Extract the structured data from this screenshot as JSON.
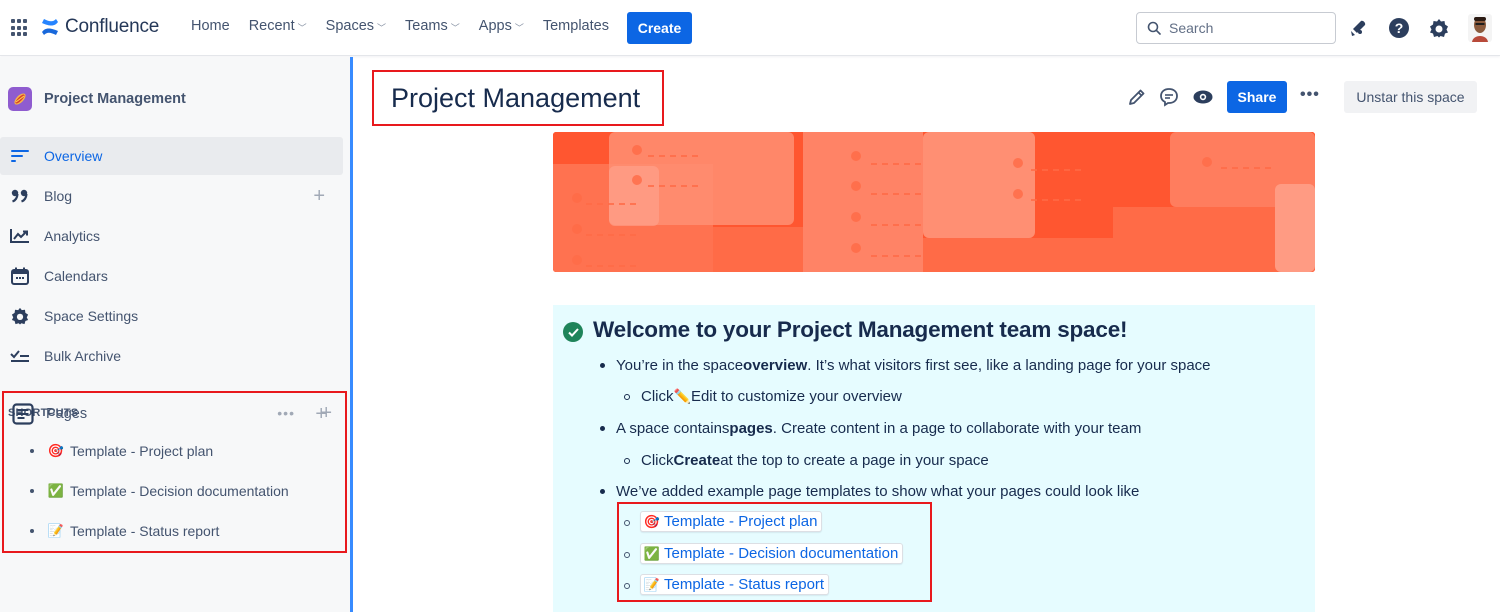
{
  "topnav": {
    "product_name": "Confluence",
    "nav_items": [
      {
        "label": "Home",
        "has_dropdown": false
      },
      {
        "label": "Recent",
        "has_dropdown": true
      },
      {
        "label": "Spaces",
        "has_dropdown": true
      },
      {
        "label": "Teams",
        "has_dropdown": true
      },
      {
        "label": "Apps",
        "has_dropdown": true
      },
      {
        "label": "Templates",
        "has_dropdown": false
      }
    ],
    "create_label": "Create",
    "search_placeholder": "Search",
    "icons": [
      "notifications-icon",
      "help-icon",
      "settings-icon",
      "user-avatar"
    ]
  },
  "sidebar": {
    "space_name": "Project Management",
    "items": [
      {
        "label": "Overview",
        "icon": "overview-icon",
        "active": true
      },
      {
        "label": "Blog",
        "icon": "quote-icon",
        "active": false,
        "has_add": true
      },
      {
        "label": "Analytics",
        "icon": "analytics-icon",
        "active": false
      },
      {
        "label": "Calendars",
        "icon": "calendar-icon",
        "active": false
      },
      {
        "label": "Space Settings",
        "icon": "gear-icon",
        "active": false
      },
      {
        "label": "Bulk Archive",
        "icon": "bulk-archive-icon",
        "active": false
      }
    ],
    "shortcuts_label": "SHORTCUTS",
    "pages_label": "Pages",
    "pages": [
      {
        "emoji": "🎯",
        "label": "Template - Project plan"
      },
      {
        "emoji": "✅",
        "label": "Template - Decision documentation"
      },
      {
        "emoji": "📝",
        "label": "Template - Status report"
      }
    ]
  },
  "main": {
    "title": "Project Management",
    "share_label": "Share",
    "more_label": "•••",
    "unstar_label": "Unstar this space",
    "welcome": {
      "heading": "Welcome to your Project Management team space!",
      "bullet1": {
        "pre": "You’re in the space ",
        "bold": "overview",
        "post": ". It’s what visitors first see, like a landing page for your space"
      },
      "sub1": {
        "pre": "Click ",
        "emoji": "✏️",
        "post": " Edit to customize your overview"
      },
      "bullet2": {
        "pre": "A space contains ",
        "bold": "pages",
        "post": ". Create content in a page to collaborate with your team"
      },
      "sub2": {
        "pre": "Click ",
        "bold": "Create",
        "post": " at the top to create a page in your space"
      },
      "bullet3": {
        "text": "We’ve added example page templates to show what your pages could look like"
      },
      "template_links": [
        {
          "emoji": "🎯",
          "label": "Template - Project plan"
        },
        {
          "emoji": "✅",
          "label": "Template - Decision documentation"
        },
        {
          "emoji": "📝",
          "label": "Template - Status report"
        }
      ]
    }
  },
  "colors": {
    "brand_blue": "#0c66e4",
    "sidebar_edge": "#388bff",
    "highlight_red": "#e8191d",
    "banner_orange": "#ff5630",
    "panel_bg": "#e6fcff",
    "success_green": "#1f845a"
  }
}
